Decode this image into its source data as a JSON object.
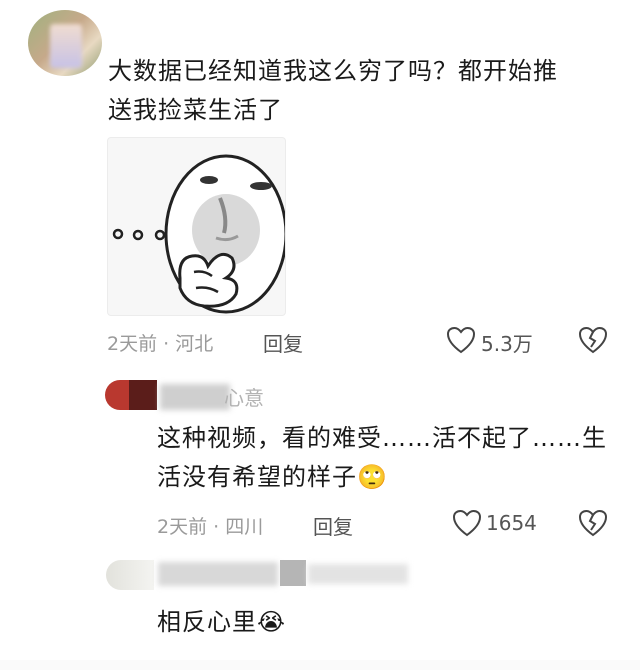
{
  "comments": [
    {
      "text_line1": "大数据已经知道我这么穷了吗？都开始推",
      "text_line2": "送我捡菜生活了",
      "time": "2天前",
      "sep": "·",
      "location": "河北",
      "reply_label": "回复",
      "like_count": "5.3万"
    },
    {
      "username": "心意",
      "text_line1": "这种视频，看的难受……活不起了……生",
      "text_line2": "活没有希望的样子",
      "emoji": "🙄",
      "time": "2天前",
      "sep": "·",
      "location": "四川",
      "reply_label": "回复",
      "like_count": "1654"
    },
    {
      "text": "相反心里",
      "emoji": "😭"
    }
  ],
  "icons": [
    "heart-icon",
    "broken-heart-icon"
  ],
  "colors": {
    "meta_gray": "#9a9a9a",
    "text": "#1a1a1a"
  }
}
